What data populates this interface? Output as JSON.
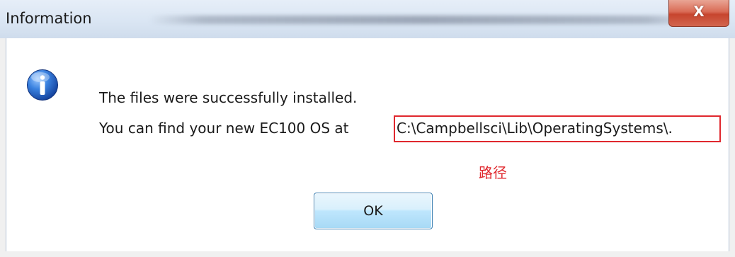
{
  "window": {
    "title": "Information",
    "close_label": "X"
  },
  "message": {
    "line1": "The files were successfully installed.",
    "line2_prefix": "You can find your new EC100 OS at",
    "path": "C:\\Campbellsci\\Lib\\OperatingSystems\\.",
    "annotation": "路径"
  },
  "buttons": {
    "ok_label": "OK"
  },
  "colors": {
    "annotation": "#e0282e",
    "ok_border": "#3c7fb1",
    "icon_blue": "#1e64c8"
  },
  "icons": {
    "info": "info-icon"
  }
}
